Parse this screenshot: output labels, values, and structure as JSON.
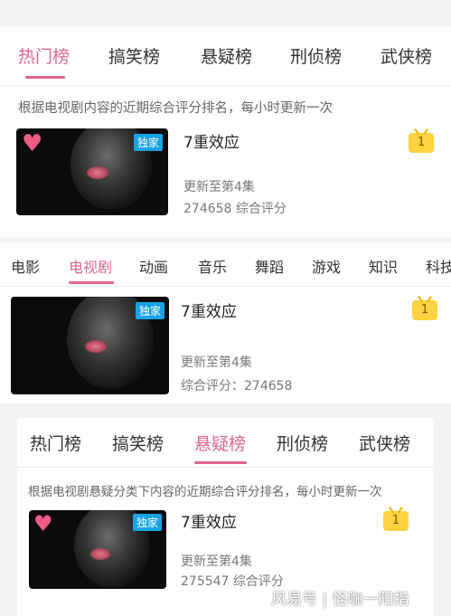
{
  "section1": {
    "tabs": [
      "热门榜",
      "搞笑榜",
      "悬疑榜",
      "刑侦榜",
      "武侠榜"
    ],
    "active_tab": "热门榜",
    "description": "根据电视剧内容的近期综合评分排名，每小时更新一次",
    "item": {
      "badge": "独家",
      "title": "7重效应",
      "update": "更新至第4集",
      "score": "274658 综合评分",
      "rank": "1"
    }
  },
  "section2": {
    "categories": [
      "电影",
      "电视剧",
      "动画",
      "音乐",
      "舞蹈",
      "游戏",
      "知识",
      "科技"
    ],
    "active_category": "电视剧",
    "item": {
      "badge": "独家",
      "title": "7重效应",
      "update": "更新至第4集",
      "score": "综合评分：274658",
      "rank": "1"
    }
  },
  "section3": {
    "tabs": [
      "热门榜",
      "搞笑榜",
      "悬疑榜",
      "刑侦榜",
      "武侠榜"
    ],
    "active_tab": "悬疑榜",
    "description": "根据电视剧悬疑分类下内容的近期综合评分排名，每小时更新一次",
    "item": {
      "badge": "独家",
      "title": "7重效应",
      "update": "更新至第4集",
      "score": "275547 综合评分",
      "rank": "1"
    }
  },
  "watermark": "风易号 | 怪咖一阳指",
  "colors": {
    "accent": "#e2668f",
    "badge": "#19a3e6",
    "rank": "#ffd23f"
  }
}
